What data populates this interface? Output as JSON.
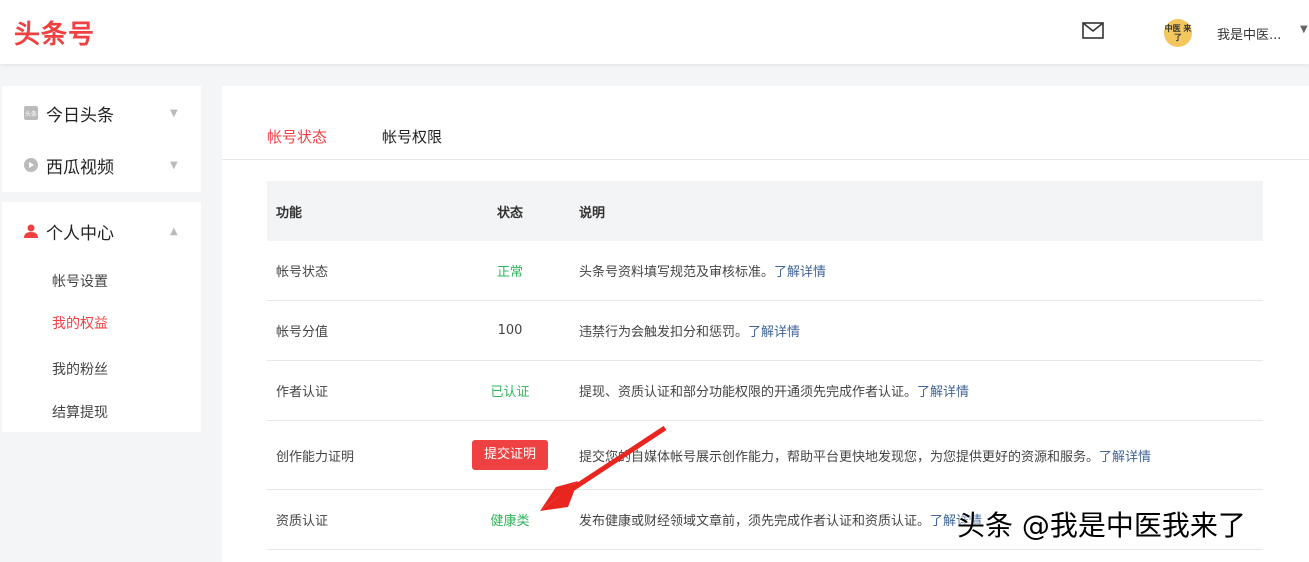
{
  "header": {
    "logo": "头条号",
    "username": "我是中医...",
    "avatar_text": "中医 来了",
    "mail_icon": "mail-icon"
  },
  "sidebar": {
    "groups": [
      {
        "label": "今日头条",
        "icon": "toutiao-icon"
      },
      {
        "label": "西瓜视频",
        "icon": "xigua-icon"
      },
      {
        "label": "个人中心",
        "icon": "user-icon"
      }
    ],
    "sub_items": [
      "帐号设置",
      "我的权益",
      "我的粉丝",
      "结算提现"
    ],
    "active_sub": "我的权益"
  },
  "tabs": [
    "帐号状态",
    "帐号权限"
  ],
  "table": {
    "headers": [
      "功能",
      "状态",
      "说明"
    ],
    "rows": [
      {
        "feature": "帐号状态",
        "status": "正常",
        "desc": "头条号资料填写规范及审核标准。",
        "link": "了解详情"
      },
      {
        "feature": "帐号分值",
        "status": "100",
        "desc": "违禁行为会触发扣分和惩罚。",
        "link": "了解详情"
      },
      {
        "feature": "作者认证",
        "status": "已认证",
        "desc": "提现、资质认证和部分功能权限的开通须先完成作者认证。",
        "link": "了解详情"
      },
      {
        "feature": "创作能力证明",
        "status": "提交证明",
        "desc": "提交您的自媒体帐号展示创作能力，帮助平台更快地发现您，为您提供更好的资源和服务。",
        "link": "了解详情"
      },
      {
        "feature": "资质认证",
        "status": "健康类",
        "desc": "发布健康或财经领域文章前，须先完成作者认证和资质认证。",
        "link": "了解详情"
      }
    ]
  },
  "watermark": "头条 @我是中医我来了",
  "colors": {
    "brand": "#f04142",
    "green": "#2fb55a",
    "link": "#406599"
  }
}
